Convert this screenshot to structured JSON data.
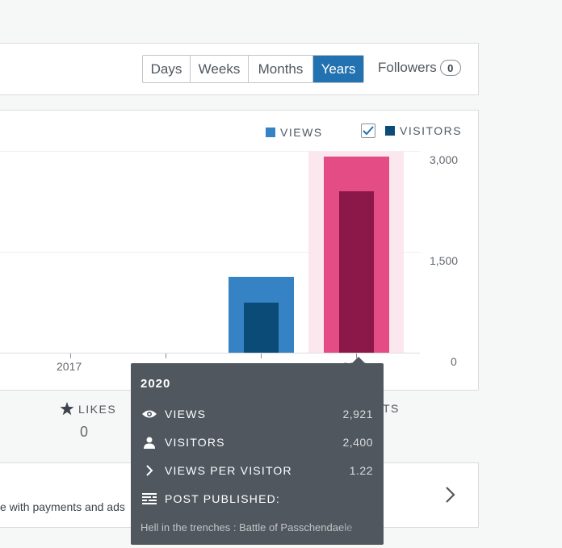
{
  "toolbar": {
    "periods": [
      {
        "label": "Days",
        "active": false
      },
      {
        "label": "Weeks",
        "active": false
      },
      {
        "label": "Months",
        "active": false
      },
      {
        "label": "Years",
        "active": true
      }
    ],
    "followers_label": "Followers",
    "followers_count": "0"
  },
  "legend": {
    "views_label": "VIEWS",
    "visitors_label": "VISITORS",
    "visitors_checked": true,
    "views_color": "#3582c4",
    "visitors_color": "#0a4b78"
  },
  "chart_data": {
    "type": "bar",
    "categories": [
      "",
      "2017",
      "",
      "",
      "2020"
    ],
    "series": [
      {
        "name": "VIEWS",
        "values": [
          0,
          0,
          0,
          1130,
          2921
        ]
      },
      {
        "name": "VISITORS",
        "values": [
          0,
          0,
          0,
          740,
          2400
        ]
      }
    ],
    "y_ticks": [
      "3,000",
      "1,500",
      "0"
    ],
    "ylim": [
      0,
      3000
    ],
    "highlight_index": 4,
    "highlight_colors": {
      "views": "#e34c84",
      "visitors": "#8c1749",
      "band": "#fbe8ef"
    }
  },
  "stats": {
    "likes_label": "LIKES",
    "likes_value": "0",
    "partial_label": "TS"
  },
  "promo": {
    "text": "e with payments and ads"
  },
  "tooltip": {
    "title": "2020",
    "rows": [
      {
        "icon": "eye-icon",
        "label": "VIEWS",
        "value": "2,921"
      },
      {
        "icon": "person-icon",
        "label": "VISITORS",
        "value": "2,400"
      },
      {
        "icon": "chevron-right-icon",
        "label": "VIEWS PER VISITOR",
        "value": "1.22"
      },
      {
        "icon": "posts-icon",
        "label": "POST PUBLISHED:",
        "value": ""
      }
    ],
    "post_title": "Hell in the trenches : Battle of Passchendaele"
  }
}
